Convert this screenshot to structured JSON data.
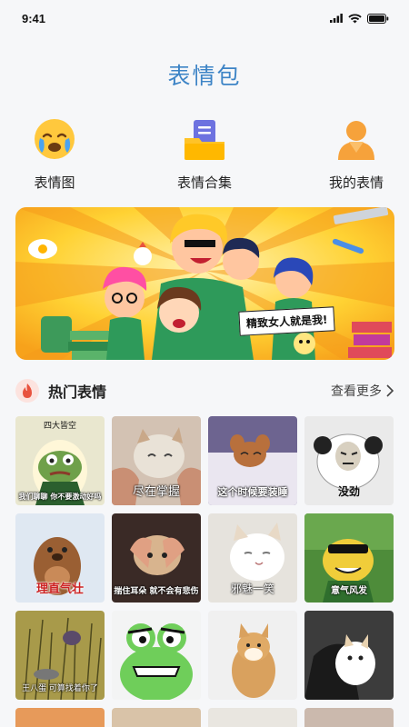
{
  "status": {
    "time": "9:41"
  },
  "title": "表情包",
  "categories": [
    {
      "label": "表情图",
      "icon": "crying-face-icon"
    },
    {
      "label": "表情合集",
      "icon": "collection-folder-icon"
    },
    {
      "label": "我的表情",
      "icon": "user-icon"
    }
  ],
  "banner": {
    "caption": "精致女人就是我!"
  },
  "hot": {
    "title": "热门表情",
    "more": "查看更多"
  },
  "tiles": [
    {
      "caption": "",
      "top": "四大皆空",
      "bottom2": "我们聊聊 你不要激动好吗"
    },
    {
      "caption": "尽在掌握"
    },
    {
      "caption": "这个时候要装睡"
    },
    {
      "caption": "没劲"
    },
    {
      "caption": "理直气壮"
    },
    {
      "caption": "揣住耳朵 就不会有悲伤"
    },
    {
      "caption": "邪魅一笑"
    },
    {
      "caption": "意气风发"
    },
    {
      "caption": "王八蛋 可算找着你了"
    },
    {
      "caption": ""
    },
    {
      "caption": ""
    },
    {
      "caption": ""
    }
  ],
  "colors": {
    "accent": "#3d84c6",
    "fire": "#e8533f"
  }
}
